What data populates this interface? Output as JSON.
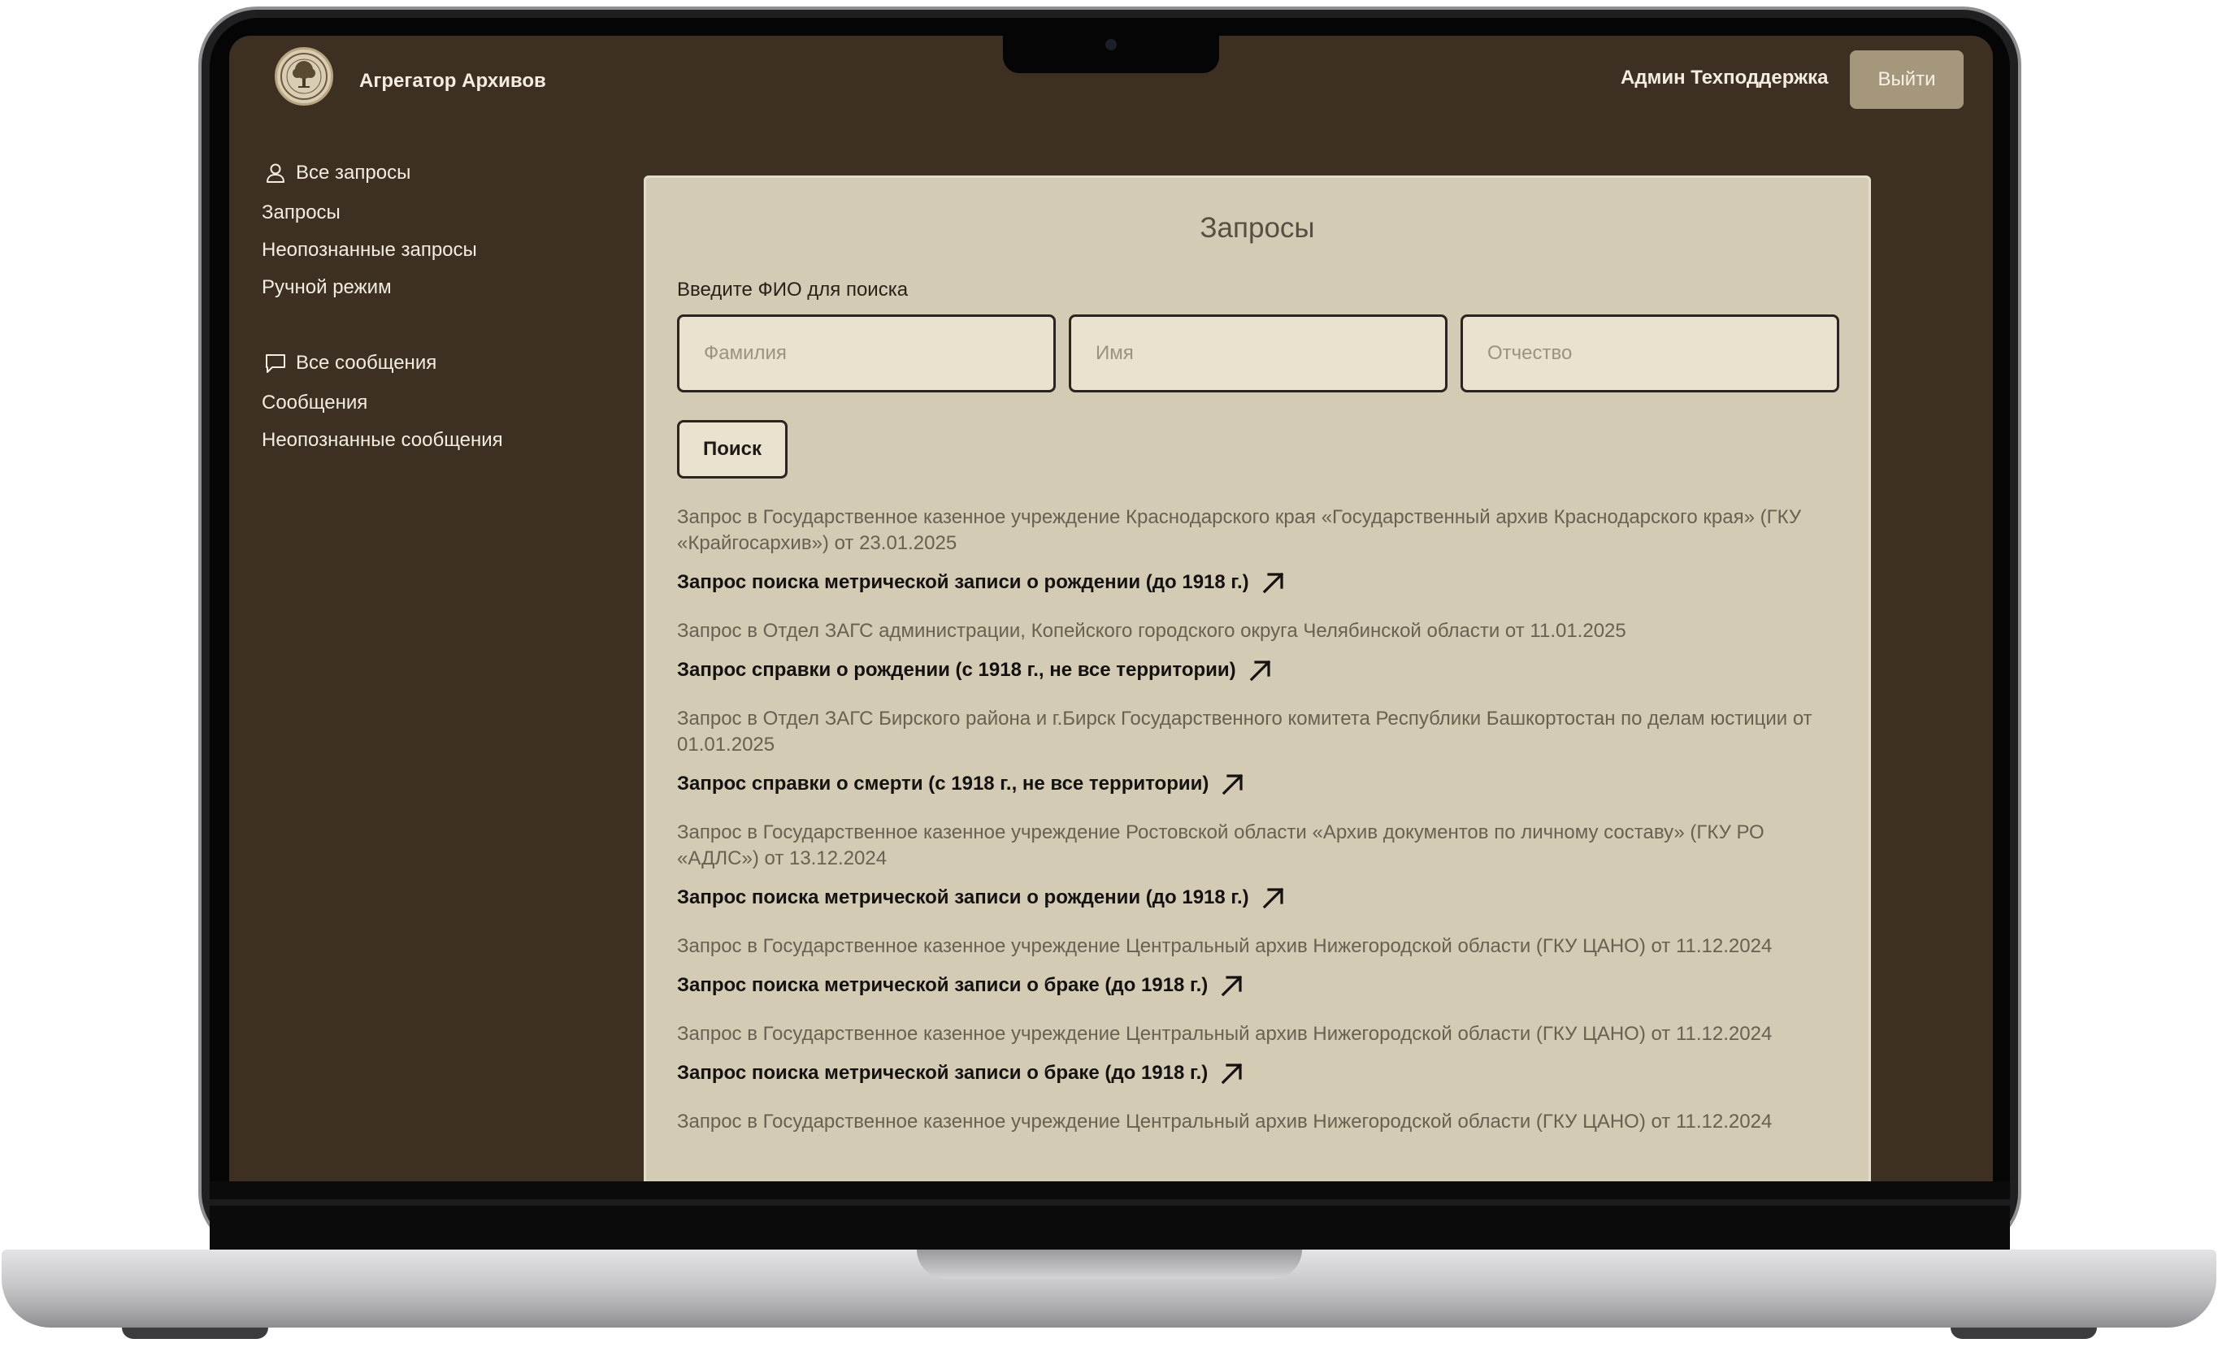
{
  "app": {
    "title": "Агрегатор Архивов"
  },
  "header": {
    "user_name": "Админ Техподдержка",
    "logout_label": "Выйти"
  },
  "sidebar": {
    "groups": [
      {
        "heading": "Все запросы",
        "icon": "user-icon",
        "items": [
          "Запросы",
          "Неопознанные запросы",
          "Ручной режим"
        ]
      },
      {
        "heading": "Все сообщения",
        "icon": "message-icon",
        "items": [
          "Сообщения",
          "Неопознанные сообщения"
        ]
      }
    ]
  },
  "main": {
    "title": "Запросы",
    "search": {
      "label": "Введите ФИО для поиска",
      "surname_placeholder": "Фамилия",
      "name_placeholder": "Имя",
      "patronymic_placeholder": "Отчество",
      "button_label": "Поиск"
    },
    "requests": [
      {
        "org": "Запрос в Государственное казенное учреждение Краснодарского края «Государственный архив Краснодарского края» (ГКУ «Крайгосархив») от 23.01.2025",
        "type": "Запрос поиска метрической записи о рождении (до 1918 г.)"
      },
      {
        "org": "Запрос в Отдел ЗАГС администрации, Копейского городского округа Челябинской области от 11.01.2025",
        "type": "Запрос справки о рождении (с 1918 г., не все территории)"
      },
      {
        "org": "Запрос в Отдел ЗАГС Бирского района и г.Бирск Государственного комитета Республики Башкортостан по делам юстиции от 01.01.2025",
        "type": "Запрос справки о смерти (с 1918 г., не все территории)"
      },
      {
        "org": "Запрос в Государственное казенное учреждение Ростовской области «Архив документов по личному составу» (ГКУ РО «АДЛС») от 13.12.2024",
        "type": "Запрос поиска метрической записи о рождении (до 1918 г.)"
      },
      {
        "org": "Запрос в Государственное казенное учреждение Центральный архив Нижегородской области (ГКУ ЦАНО) от 11.12.2024",
        "type": "Запрос поиска метрической записи о браке (до 1918 г.)"
      },
      {
        "org": "Запрос в Государственное казенное учреждение Центральный архив Нижегородской области (ГКУ ЦАНО) от 11.12.2024",
        "type": "Запрос поиска метрической записи о браке (до 1918 г.)"
      },
      {
        "org": "Запрос в Государственное казенное учреждение Центральный архив Нижегородской области (ГКУ ЦАНО) от 11.12.2024",
        "type": ""
      }
    ]
  },
  "colors": {
    "app_background": "#3e2f23",
    "panel_background": "#d3cbb4",
    "input_background": "#e8e2cf",
    "logout_button": "#a5977c",
    "text_light": "#f3ece0"
  }
}
